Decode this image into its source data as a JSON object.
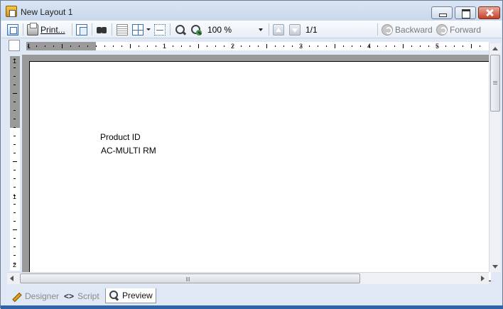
{
  "window": {
    "title": "New Layout 1"
  },
  "toolbar": {
    "print_label": "Print...",
    "zoom_value": "100 %",
    "page_indicator": "1/1",
    "backward_label": "Backward",
    "forward_label": "Forward"
  },
  "rulers": {
    "horizontal_numbers": [
      "1",
      "1",
      "2",
      "3",
      "4",
      "5"
    ],
    "vertical_numbers": [
      "1",
      "1",
      "2"
    ]
  },
  "page": {
    "field_label": "Product ID",
    "field_value": "AC-MULTI RM"
  },
  "tabs": [
    {
      "label": "Designer",
      "icon": "pencil-icon",
      "active": false
    },
    {
      "label": "Script",
      "icon": "code-icon",
      "active": false
    },
    {
      "label": "Preview",
      "icon": "magnifier-icon",
      "active": true
    }
  ],
  "colors": {
    "ruler_margin": "#9a9a9a",
    "doc_background": "#9a9a9a",
    "window_frame": "#dfe8f4"
  }
}
